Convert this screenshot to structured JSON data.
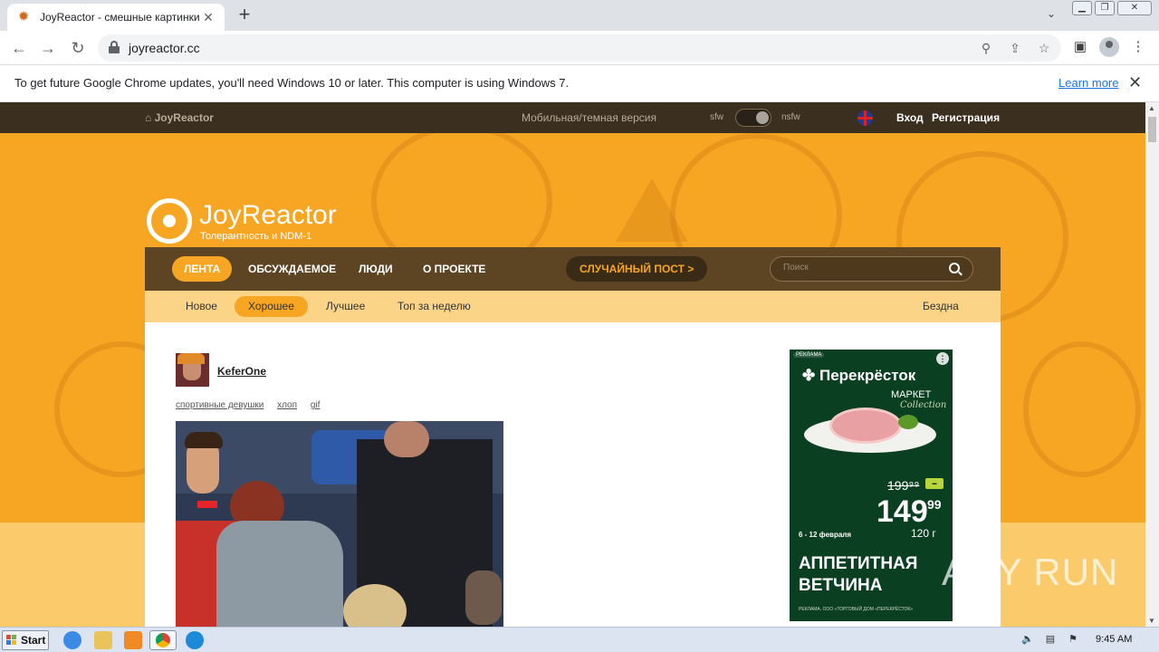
{
  "browser": {
    "tab_title": "JoyReactor - смешные картинки и",
    "url": "joyreactor.cc",
    "infobar_message": "To get future Google Chrome updates, you'll need Windows 10 or later. This computer is using Windows 7.",
    "infobar_link": "Learn more"
  },
  "site": {
    "topbar": {
      "home_label": "JoyReactor",
      "mobile_label": "Мобильная/темная версия",
      "sfw_label": "sfw",
      "nsfw_label": "nsfw",
      "login_label": "Вход",
      "register_label": "Регистрация"
    },
    "logo": {
      "name": "JoyReactor",
      "slogan": "Толерантность и NDM-1"
    },
    "main_nav": {
      "items": [
        "ЛЕНТА",
        "ОБСУЖДАЕМОЕ",
        "ЛЮДИ",
        "О ПРОЕКТЕ"
      ],
      "active_index": 0,
      "random_label": "СЛУЧАЙНЫЙ ПОСТ >",
      "search_placeholder": "Поиск"
    },
    "sub_nav": {
      "items": [
        "Новое",
        "Хорошее",
        "Лучшее",
        "Топ за неделю"
      ],
      "active_index": 1,
      "right_item": "Бездна"
    },
    "post": {
      "author": "KeferOne",
      "tags": [
        "спортивные девушки",
        "хлоп",
        "gif"
      ]
    },
    "ad": {
      "label": "РЕКЛАМА",
      "brand": "Перекрёсток",
      "sub_brand": "МАРКЕТ",
      "collection": "Collection",
      "old_price": "199⁹⁹",
      "price": "149",
      "price_cents": "99",
      "weight": "120 г",
      "dates": "6 - 12 февраля",
      "headline_1": "АППЕТИТНАЯ",
      "headline_2": "ВЕТЧИНА",
      "legal": "РЕКЛАМА. ООО «ТОРГОВЫЙ ДОМ «ПЕРЕКРЁСТОК»"
    }
  },
  "watermark": "ANY RUN",
  "taskbar": {
    "start_label": "Start",
    "clock": "9:45 AM"
  },
  "colors": {
    "accent": "#f6a623",
    "nav_dark": "#5d4524",
    "topbar": "#3b2f20",
    "subnav": "#fcd488",
    "ad_green": "#0a3f22"
  }
}
